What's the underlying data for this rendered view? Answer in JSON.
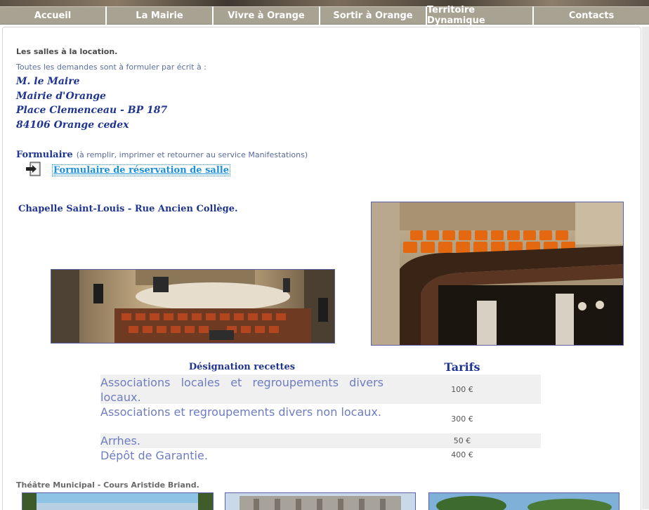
{
  "nav": {
    "items": [
      {
        "label": "Accueil"
      },
      {
        "label": "La Mairie"
      },
      {
        "label": "Vivre à Orange"
      },
      {
        "label": "Sortir à Orange"
      },
      {
        "label": "Territoire Dynamique"
      },
      {
        "label": "Contacts"
      }
    ]
  },
  "intro": {
    "heading": "Les salles à la location.",
    "subheading": "Toutes les demandes sont à formuler par écrit à :"
  },
  "address": {
    "line1": "M. le Maire",
    "line2": "Mairie d'Orange",
    "line3": "Place Clemenceau - BP 187",
    "line4": "84106 Orange cedex"
  },
  "form": {
    "title": "Formulaire",
    "note": "(à remplir, imprimer et retourner au service Manifestations)",
    "link_label": "Formulaire de réservation de salle"
  },
  "chapelle": {
    "title": "Chapelle Saint-Louis - Rue Ancien Collège."
  },
  "tarifs": {
    "header_designation": "Désignation recettes",
    "header_tarifs": "Tarifs",
    "rows": [
      {
        "designation": "Associations locales et regroupements divers locaux.",
        "price": "100 €"
      },
      {
        "designation": "Associations et regroupements divers non locaux.",
        "price": "300 €"
      },
      {
        "designation": "Arrhes.",
        "price": "50 €"
      },
      {
        "designation": "Dépôt de Garantie.",
        "price": "400 €"
      }
    ]
  },
  "theatre": {
    "title": "Théâtre Municipal - Cours Aristide Briand."
  },
  "colors": {
    "nav_bg": "#a8a293",
    "title_blue": "#1f3590",
    "desc_blue": "#6e7cc0",
    "link_blue": "#1a8fd8"
  }
}
